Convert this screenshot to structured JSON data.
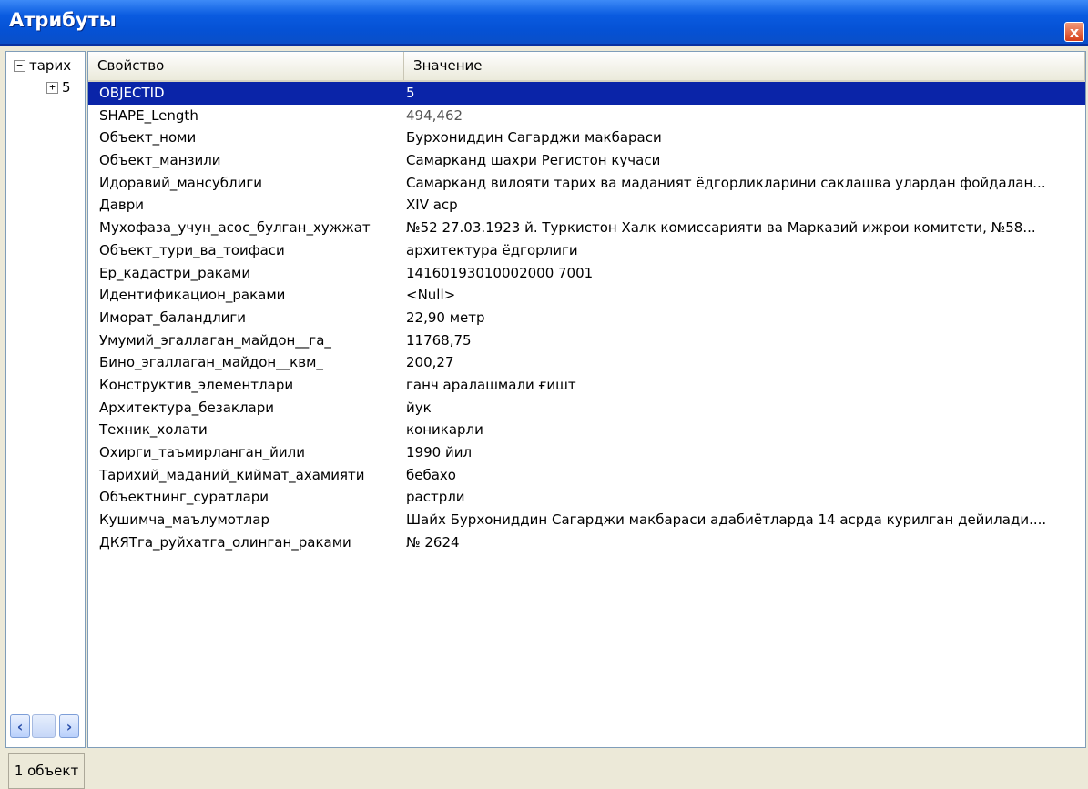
{
  "window": {
    "title": "Атрибуты",
    "close_label": "x"
  },
  "tree": {
    "root_label": "тарих",
    "child_label": "5",
    "expander_root": "−",
    "expander_child": "+"
  },
  "status": {
    "text": "1 объект"
  },
  "grid": {
    "headers": {
      "property": "Свойство",
      "value": "Значение"
    },
    "rows": [
      {
        "property": "OBJECTID",
        "value": "5"
      },
      {
        "property": "SHAPE_Length",
        "value": "494,462"
      },
      {
        "property": "Объект_номи",
        "value": "Бурхониддин Сагарджи макбараси"
      },
      {
        "property": "Объект_манзили",
        "value": "Самарканд шахри Регистон кучаси"
      },
      {
        "property": "Идоравий_мансублиги",
        "value": "Самарканд вилояти тарих ва маданият ёдгорликларини саклашва улардан фойдалан..."
      },
      {
        "property": "Даври",
        "value": "XIV аср"
      },
      {
        "property": "Мухофаза_учун_асос_булган_хужжат",
        "value": "№52 27.03.1923 й. Туркистон Халк комиссарияти ва Марказий ижрои комитети, №58..."
      },
      {
        "property": "Объект_тури_ва_тоифаси",
        "value": "архитектура ёдгорлиги"
      },
      {
        "property": "Ер_кадастри_раками",
        "value": "14160193010002000 7001"
      },
      {
        "property": "Идентификацион_раками",
        "value": "<Null>"
      },
      {
        "property": "Иморат_баландлиги",
        "value": "22,90 метр"
      },
      {
        "property": "Умумий_эгаллаган_майдон__га_",
        "value": "11768,75"
      },
      {
        "property": "Бино_эгаллаган_майдон__квм_",
        "value": "200,27"
      },
      {
        "property": "Конструктив_элементлари",
        "value": "ганч аралашмали ғишт"
      },
      {
        "property": "Архитектура_безаклари",
        "value": "йук"
      },
      {
        "property": "Техник_холати",
        "value": "коникарли"
      },
      {
        "property": "Охирги_таъмирланган_йили",
        "value": "1990 йил"
      },
      {
        "property": "Тарихий_маданий_киймат_ахамияти",
        "value": "бебахо"
      },
      {
        "property": "Объектнинг_суратлари",
        "value": "растрли"
      },
      {
        "property": "Кушимча_маълумотлар",
        "value": "Шайх Бурхониддин Сагарджи макбараси адабиётларда 14 асрда курилган дейилади...."
      },
      {
        "property": "ДКЯТга_руйхатга_олинган_раками",
        "value": "№ 2624"
      }
    ]
  },
  "colors": {
    "titlebar": "#0551d4",
    "selection": "#0a24a8"
  },
  "icons": [
    "close-icon",
    "collapse-icon",
    "expand-icon",
    "scroll-left-icon",
    "scroll-right-icon"
  ]
}
